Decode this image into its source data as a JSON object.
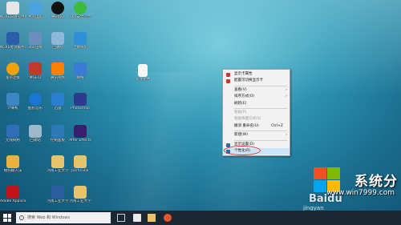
{
  "desktop": {
    "icons": [
      {
        "label": "NCRE日语应用管理系统",
        "color": "#e6e6e6"
      },
      {
        "label": "我的电脑",
        "color": "#4aa3df"
      },
      {
        "label": "腾讯QQ",
        "color": "#111111"
      },
      {
        "label": "360安全卫士",
        "color": "#3dbb3d"
      },
      {
        "label": "NCRE考试服务系统",
        "color": "#2a5caa"
      },
      {
        "label": "360压缩",
        "color": "#6c8ebf"
      },
      {
        "label": "回收站",
        "color": "#8fb7d6"
      },
      {
        "label": "上网导航",
        "color": "#2f8fd9"
      },
      {
        "label": "宽带连接",
        "color": "#f2a20c"
      },
      {
        "label": "MGECI",
        "color": "#c0392b"
      },
      {
        "label": "腾讯视频",
        "color": "#ff7f00"
      },
      {
        "label": "网络",
        "color": "#3a7bd5"
      },
      {
        "label": "计算机",
        "color": "#3d86c6"
      },
      {
        "label": "酷狗音乐",
        "color": "#1976d2"
      },
      {
        "label": "迅雷",
        "color": "#2b7fd1"
      },
      {
        "label": "Photoshop",
        "color": "#2b3b8f"
      },
      {
        "label": "控制面板",
        "color": "#2e7ab8"
      },
      {
        "label": "回收站",
        "color": "#9fb9cc"
      },
      {
        "label": "After Effects",
        "color": "#3a1e6e"
      },
      {
        "label": "无线网络",
        "color": "#2f6fb5"
      },
      {
        "label": "搜狗输入法",
        "color": "#e7b33c"
      },
      {
        "label": "河南工业大学",
        "color": "#e8c36a"
      },
      {
        "label": "particular",
        "color": "#e8c36a"
      },
      {
        "label": "Adobe Application",
        "color": "#c0141b"
      },
      {
        "label": "河南工业大学",
        "color": "#2c5d9e"
      },
      {
        "label": "河南工业大学",
        "color": "#e8c36a"
      },
      {
        "label": "新建文件",
        "color": "#f5f5f5"
      }
    ]
  },
  "context_menu": {
    "items": [
      {
        "label": "显示卡属性",
        "shortcut": "",
        "disabled": false,
        "icon_color": "#d0302b"
      },
      {
        "label": "配置可切换显示卡",
        "shortcut": "",
        "disabled": false,
        "icon_color": "#d0302b"
      },
      {
        "label": "查看(V)",
        "shortcut": "",
        "disabled": false
      },
      {
        "label": "排序方式(O)",
        "shortcut": "",
        "disabled": false
      },
      {
        "label": "刷新(E)",
        "shortcut": "",
        "disabled": false
      },
      {
        "label": "粘贴(P)",
        "shortcut": "",
        "disabled": true
      },
      {
        "label": "粘贴快捷方式(S)",
        "shortcut": "",
        "disabled": true
      },
      {
        "label": "撤消 重命名(U)",
        "shortcut": "Ctrl+Z",
        "disabled": false
      },
      {
        "label": "新建(W)",
        "shortcut": "",
        "disabled": false
      },
      {
        "label": "显示设置(D)",
        "shortcut": "",
        "disabled": false,
        "icon_color": "#2b6cb0"
      },
      {
        "label": "个性化(R)",
        "shortcut": "",
        "disabled": false,
        "icon_color": "#2b6cb0"
      }
    ]
  },
  "taskbar": {
    "search_placeholder": "搜索 Web 和 Windows"
  },
  "watermark": {
    "brand_text": "系统分",
    "url": "www.win7999.com",
    "baidu": "Baidu",
    "baidu_sub": "jingyan"
  }
}
